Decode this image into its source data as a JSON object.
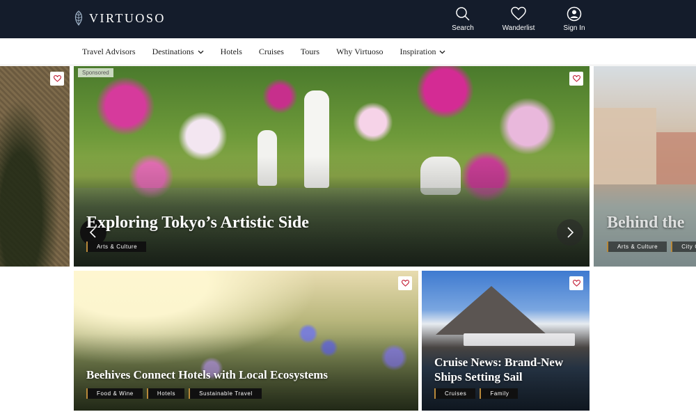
{
  "header": {
    "logo_text": "VIRTUOSO",
    "actions": [
      {
        "label": "Search",
        "icon": "search-icon"
      },
      {
        "label": "Wanderlist",
        "icon": "heart-icon"
      },
      {
        "label": "Sign In",
        "icon": "user-icon"
      }
    ]
  },
  "nav": {
    "items": [
      {
        "label": "Travel Advisors",
        "dropdown": false
      },
      {
        "label": "Destinations",
        "dropdown": true
      },
      {
        "label": "Hotels",
        "dropdown": false
      },
      {
        "label": "Cruises",
        "dropdown": false
      },
      {
        "label": "Tours",
        "dropdown": false
      },
      {
        "label": "Why Virtuoso",
        "dropdown": false
      },
      {
        "label": "Inspiration",
        "dropdown": true
      }
    ]
  },
  "carousel": {
    "sponsored_label": "Sponsored",
    "main": {
      "title": "Exploring Tokyo’s Artistic Side",
      "tags": [
        "Arts & Culture"
      ]
    },
    "next_peek": {
      "title": "Behind the",
      "tags": [
        "Arts & Culture",
        "City G"
      ]
    }
  },
  "cards": [
    {
      "title": "Beehives Connect Hotels with Local Ecosystems",
      "tags": [
        "Food & Wine",
        "Hotels",
        "Sustainable Travel"
      ]
    },
    {
      "title": "Cruise News: Brand-New Ships Setting Sail",
      "tags": [
        "Cruises",
        "Family"
      ]
    }
  ],
  "colors": {
    "header_bg": "#141c2b",
    "tag_bg": "#101010",
    "tag_accent": "#b9893a",
    "heart": "#c4233a"
  }
}
